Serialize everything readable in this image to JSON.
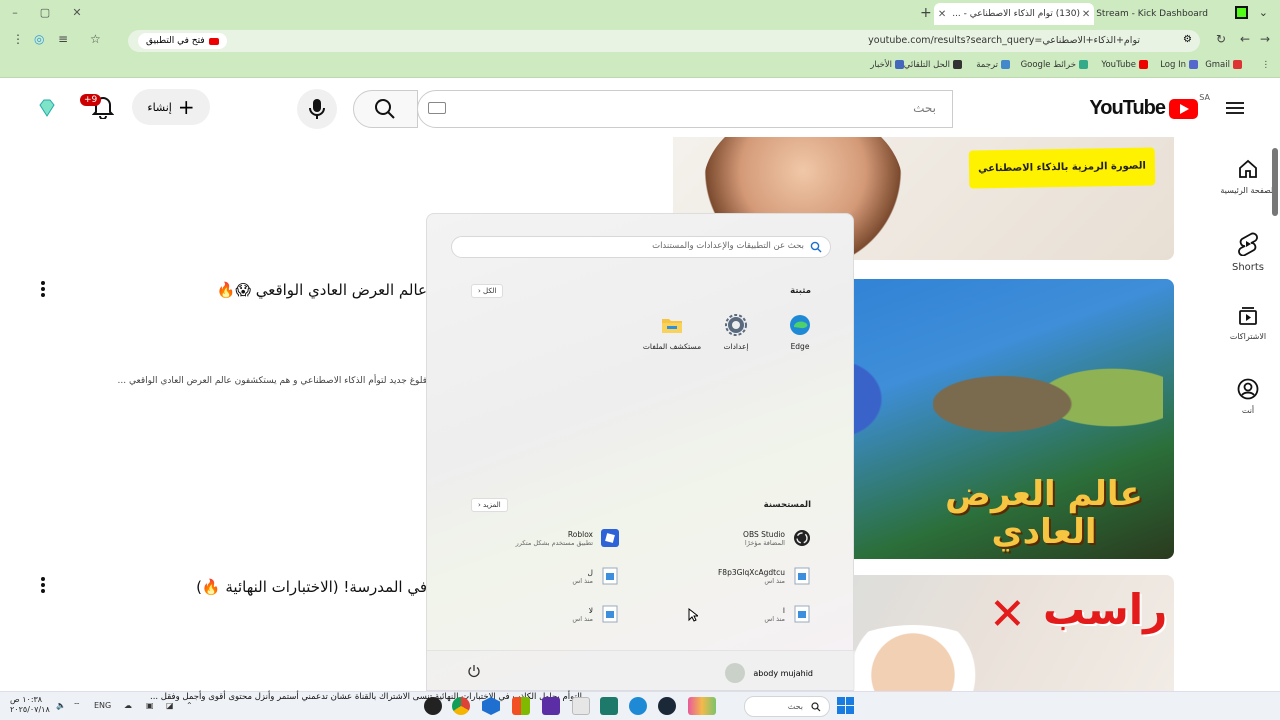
{
  "browser": {
    "tabs": [
      {
        "title": "(130) توام الذكاء الاصطناعي - ...",
        "active": true
      },
      {
        "title": "Stream - Kick Dashboard",
        "active": false
      }
    ],
    "url": "youtube.com/results?search_query=توام+الذكاء+الاصطناعي",
    "open_in_app": "فتح في التطبيق",
    "bookmarks": [
      "Gmail",
      "Log In",
      "YouTube",
      "خرائط Google",
      "ترجمة",
      "الحل التلقائي",
      "الأخبار"
    ]
  },
  "youtube": {
    "logo_text": "YouTube",
    "region": "SA",
    "search_placeholder": "بحث",
    "create_label": "إنشاء",
    "notification_count": "+9",
    "sidebar": [
      {
        "label": "الصفحة الرئيسية",
        "icon": "home-icon"
      },
      {
        "label": "Shorts",
        "icon": "shorts-icon"
      },
      {
        "label": "الاشتراكات",
        "icon": "subscriptions-icon"
      },
      {
        "label": "أنت",
        "icon": "you-icon"
      }
    ],
    "thumb1_banner": "الصورة الرمزية بالذكاء الاصطناعي",
    "thumb2_text": "عالم العرض العادي",
    "thumb3_text": "راسب",
    "videos": [
      {
        "title": "عالم العرض العادي الواقعي 😱🔥",
        "desc": "فلوغ جديد لتوأم الذكاء الاصطناعي و هم يستكشفون عالم العرض العادي الواقعي ..."
      },
      {
        "title": "في المدرسة! (الاختبارات النهائية 🔥)",
        "desc": ""
      }
    ]
  },
  "start_menu": {
    "search_placeholder": "بحث عن التطبيقات والإعدادات والمستندات",
    "pinned_label": "مثبتة",
    "all_label": "الكل",
    "pinned": [
      {
        "name": "Edge",
        "icon": "edge-icon"
      },
      {
        "name": "إعدادات",
        "icon": "settings-gear-icon"
      },
      {
        "name": "مستكشف الملفات",
        "icon": "folder-icon"
      }
    ],
    "recommended_label": "المستحسنة",
    "more_label": "المزيد",
    "recommended": [
      {
        "name": "OBS Studio",
        "sub": "المضافة مؤخرًا"
      },
      {
        "name": "Roblox",
        "sub": "تطبيق مستخدم بشكل متكرر"
      },
      {
        "name": "F8p3GlqXcAgdtcu",
        "sub": "منذ اس"
      },
      {
        "name": "ل",
        "sub": "منذ اس"
      },
      {
        "name": "ا",
        "sub": "منذ اس"
      },
      {
        "name": "لا",
        "sub": "منذ اس"
      }
    ],
    "user": "abody mujahid"
  },
  "taskbar": {
    "time": "١٠:٣٨ ص",
    "date": "٢٠٢٥/٠٧/١٨",
    "lang": "ENG",
    "search_placeholder": "بحث",
    "ticker": "التوأم يحاول الكاذب في الاختبارات النهائية تنسى الاشتراك بالقناة عشان تدعمني أستمر وأنزل محتوى أقوى وأجمل وفقل ..."
  },
  "colors": {
    "tab_bg": "#cdeac0",
    "yt_red": "#ff0000",
    "kick_green": "#53fc18"
  }
}
